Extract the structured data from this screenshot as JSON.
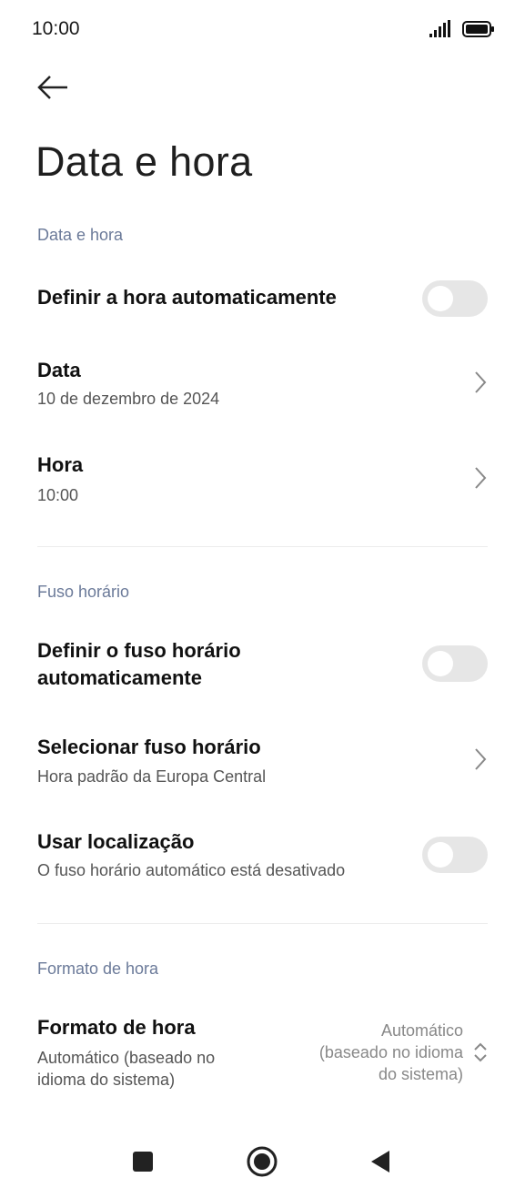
{
  "status_bar": {
    "time": "10:00",
    "signal_icon": "signal-bars-icon",
    "battery_icon": "battery-icon"
  },
  "header": {
    "back_icon": "arrow-left-icon",
    "title": "Data e hora"
  },
  "sections": {
    "date_time": {
      "header": "Data e hora",
      "auto_time": {
        "title": "Definir a hora automaticamente",
        "enabled": false
      },
      "date": {
        "title": "Data",
        "value": "10 de dezembro de 2024"
      },
      "time": {
        "title": "Hora",
        "value": "10:00"
      }
    },
    "timezone": {
      "header": "Fuso horário",
      "auto_timezone": {
        "title_line1": "Definir o fuso horário",
        "title_line2": "automaticamente",
        "enabled": false
      },
      "select_timezone": {
        "title": "Selecionar fuso horário",
        "value": "Hora padrão da Europa Central"
      },
      "use_location": {
        "title": "Usar localização",
        "subtitle": "O fuso horário automático está desativado",
        "enabled": false
      }
    },
    "time_format": {
      "header": "Formato de hora",
      "format": {
        "title": "Formato de hora",
        "subtitle_line1": "Automático (baseado no",
        "subtitle_line2": "idioma do sistema)",
        "value_line1": "Automático",
        "value_line2": "(baseado no idioma",
        "value_line3": "do sistema)"
      }
    }
  },
  "nav_bar": {
    "recents_icon": "square-icon",
    "home_icon": "circle-home-icon",
    "back_icon": "triangle-back-icon"
  },
  "colors": {
    "section_header": "#6b7a99",
    "toggle_off": "#e6e6e6",
    "secondary_text": "#555555"
  }
}
